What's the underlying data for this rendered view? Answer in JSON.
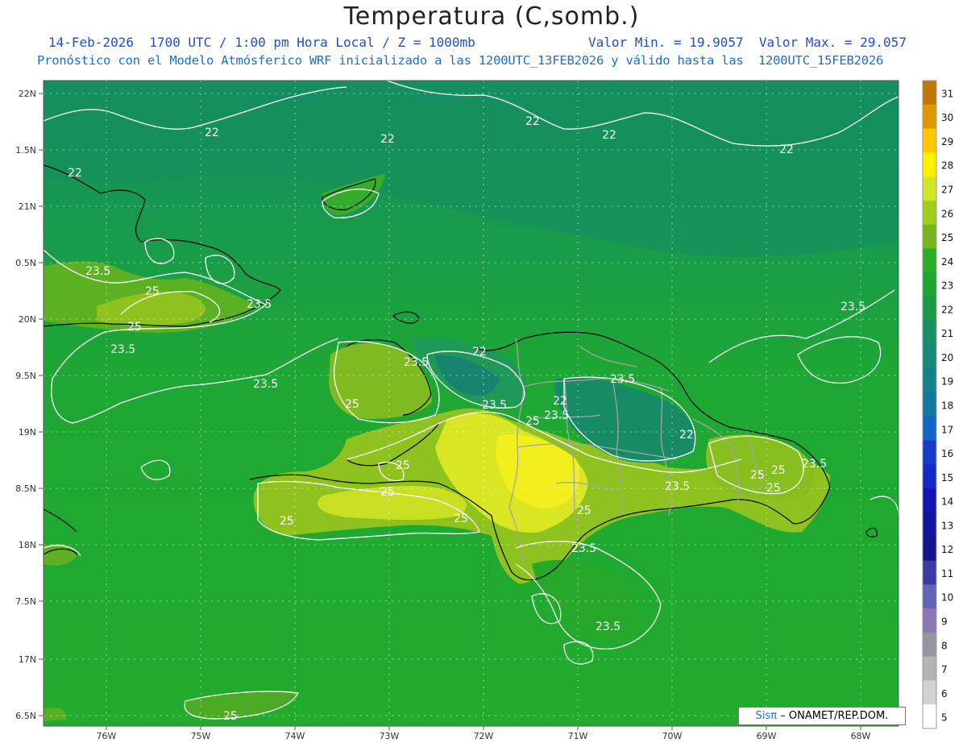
{
  "header": {
    "title": "Temperatura (C,somb.)",
    "line1_left": "14-Feb-2026  1700 UTC / 1:00 pm Hora Local / Z = 1000mb",
    "line1_right": "Valor Min. = 19.9057  Valor Max. = 29.057",
    "line2": "Pronóstico con el Modelo Atmósferico WRF inicializado a las 1200UTC_13FEB2026 y válido hasta las  1200UTC_15FEB2026"
  },
  "axes": {
    "lat_ticks": [
      "22N",
      "1.5N",
      "21N",
      "0.5N",
      "20N",
      "9.5N",
      "19N",
      "8.5N",
      "18N",
      "7.5N",
      "17N",
      "6.5N"
    ],
    "lon_ticks": [
      "76W",
      "75W",
      "74W",
      "73W",
      "72W",
      "71W",
      "70W",
      "69W",
      "68W"
    ]
  },
  "contour_labels": [
    {
      "text": "22"
    },
    {
      "text": "22"
    },
    {
      "text": "22"
    },
    {
      "text": "22"
    },
    {
      "text": "22"
    },
    {
      "text": "22"
    },
    {
      "text": "22"
    },
    {
      "text": "22"
    },
    {
      "text": "22"
    },
    {
      "text": "23.5"
    },
    {
      "text": "23.5"
    },
    {
      "text": "23.5"
    },
    {
      "text": "23.5"
    },
    {
      "text": "23.5"
    },
    {
      "text": "23.5"
    },
    {
      "text": "23.5"
    },
    {
      "text": "23.5"
    },
    {
      "text": "23.5"
    },
    {
      "text": "23.5"
    },
    {
      "text": "23.5"
    },
    {
      "text": "23.5"
    },
    {
      "text": "23.5"
    },
    {
      "text": "25"
    },
    {
      "text": "25"
    },
    {
      "text": "25"
    },
    {
      "text": "25"
    },
    {
      "text": "25"
    },
    {
      "text": "25"
    },
    {
      "text": "25"
    },
    {
      "text": "25"
    },
    {
      "text": "25"
    },
    {
      "text": "25"
    },
    {
      "text": "25"
    },
    {
      "text": "25"
    },
    {
      "text": "25"
    }
  ],
  "colorbar": {
    "labels": [
      "31",
      "30",
      "29",
      "28",
      "27",
      "26",
      "25",
      "24",
      "23",
      "22",
      "21",
      "20",
      "19",
      "18",
      "17",
      "16",
      "15",
      "14",
      "13",
      "12",
      "11",
      "10",
      "9",
      "8",
      "7",
      "6",
      "5"
    ],
    "colors": [
      "#c07800",
      "#e09800",
      "#ffc800",
      "#fff000",
      "#d2e628",
      "#a0cd1e",
      "#78b41e",
      "#28af28",
      "#1ea532",
      "#1a9a46",
      "#169064",
      "#168a78",
      "#14828c",
      "#1478a0",
      "#1464c8",
      "#143cc8",
      "#1428c8",
      "#1414b4",
      "#1414a0",
      "#14148c",
      "#3c3ca0",
      "#6464b4",
      "#8c78b4",
      "#9696a0",
      "#b4b4b4",
      "#d2d2d2",
      "#ffffff"
    ]
  },
  "credit": {
    "logo": "Sisπ",
    "text": "– ONAMET/REP.DOM."
  },
  "colors": {
    "sea": "#1fa22e",
    "northern_sea": "#16935a",
    "land_warm": "#8ec21e",
    "land_hot": "#e8ec20",
    "contour": "#ffffff",
    "coast": "#000000",
    "border": "#a0a0a0"
  }
}
